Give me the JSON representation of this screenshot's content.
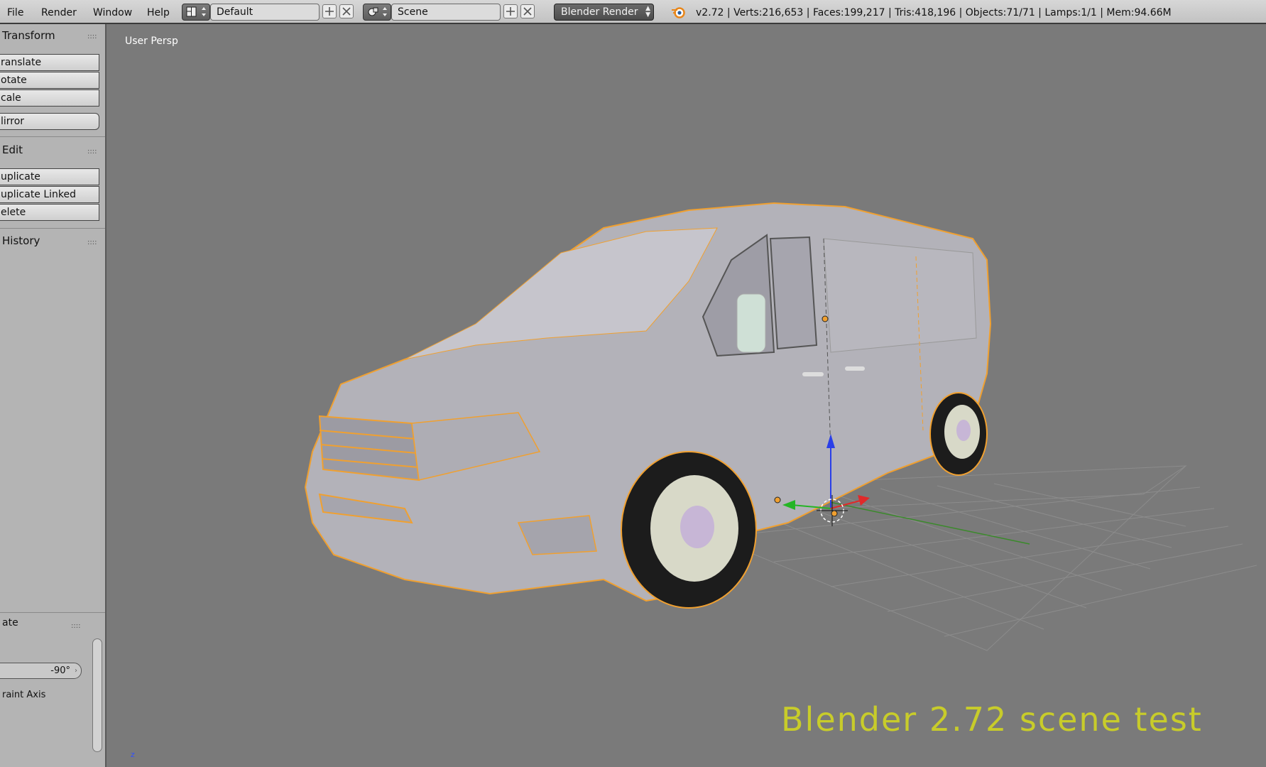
{
  "menu": [
    "File",
    "Render",
    "Window",
    "Help"
  ],
  "screen_layout": {
    "value": "Default",
    "icon": "screen-layout-icon"
  },
  "scene": {
    "value": "Scene",
    "icon": "scene-icon"
  },
  "render_engine": "Blender Render",
  "stats": "v2.72 | Verts:216,653 | Faces:199,217 | Tris:418,196 | Objects:71/71 | Lamps:1/1 | Mem:94.66M",
  "toolshelf": {
    "transform": {
      "title": "Transform",
      "buttons": [
        "ranslate",
        "otate",
        "cale",
        "lirror"
      ]
    },
    "edit": {
      "title": "Edit",
      "buttons": [
        "uplicate",
        "uplicate Linked",
        "elete"
      ]
    },
    "history": {
      "title": "History"
    },
    "operator": {
      "title": "ate",
      "value": "-90°",
      "constraint_label": "raint Axis"
    }
  },
  "viewport": {
    "label": "User Persp",
    "watermark": "Blender 2.72 scene test",
    "axis_label": "z"
  },
  "colors": {
    "selection_outline": "#f0a030",
    "watermark": "#c8cc2a"
  }
}
